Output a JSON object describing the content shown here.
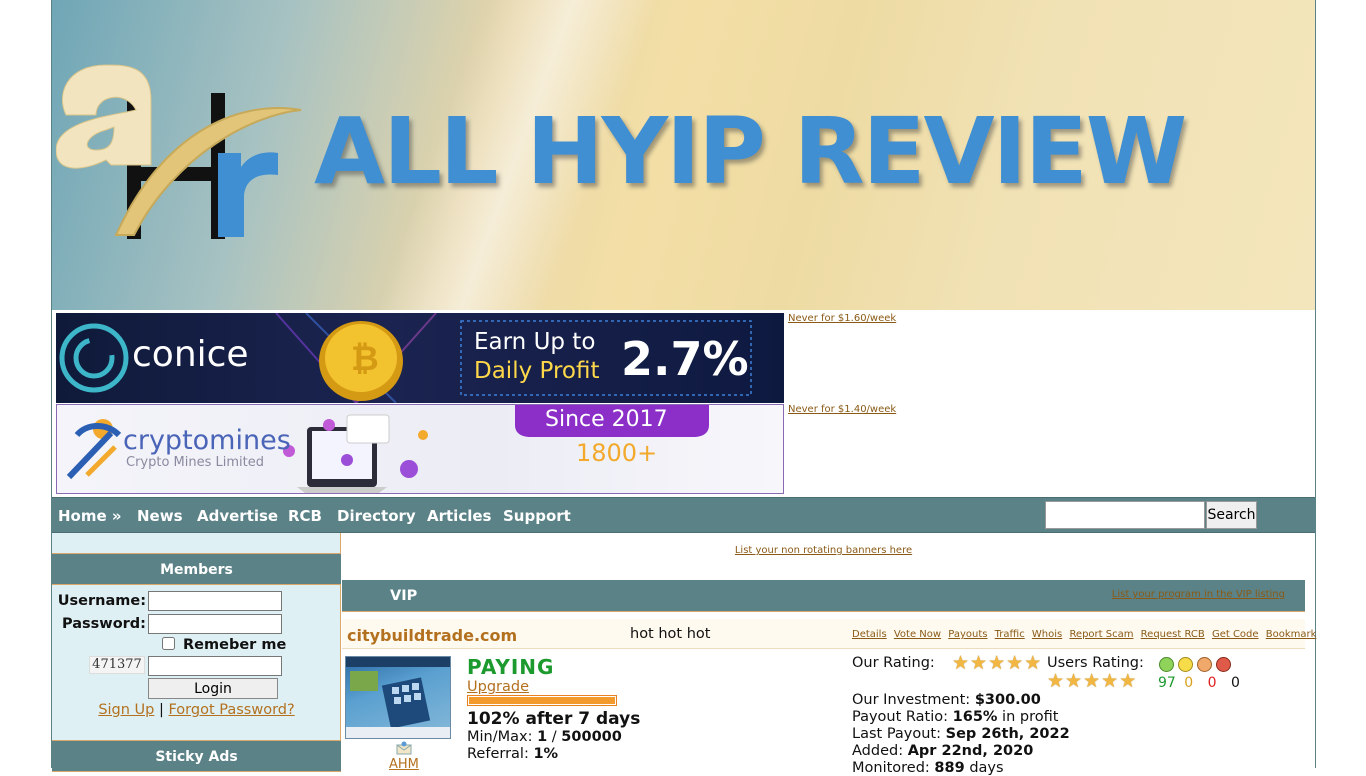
{
  "header": {
    "logo_text": "ahr",
    "title": "ALL HYIP REVIEW"
  },
  "banners": [
    {
      "brand": "conice",
      "headline_line1": "Earn Up to",
      "headline_line2": "Daily Profit",
      "figure": "2.7%",
      "side_link": "Never for $1.60/week"
    },
    {
      "brand": "cryptomines",
      "subtitle": "Crypto Mines Limited",
      "since": "Since 2017",
      "count": "1800+",
      "side_link": "Never for $1.40/week"
    }
  ],
  "nav": {
    "items": [
      "Home »",
      "News",
      "Advertise",
      "RCB",
      "Directory",
      "Articles",
      "Support"
    ],
    "search_placeholder": "",
    "search_button": "Search"
  },
  "sidebar": {
    "members_title": "Members",
    "username_label": "Username:",
    "password_label": "Password:",
    "remember_label": "Remeber me",
    "remember_checked": false,
    "captcha_text": "471377",
    "login_button": "Login",
    "signup_link": "Sign Up",
    "separator": "|",
    "forgot_link": "Forgot Password?",
    "sticky_title": "Sticky Ads"
  },
  "main": {
    "list_banners_link": "List your non rotating banners here",
    "vip_title": "VIP",
    "vip_listing_link": "List your program in the VIP listing",
    "program": {
      "name": "citybuildtrade.com",
      "tagline": "hot hot hot",
      "links": [
        "Details",
        "Vote Now",
        "Payouts",
        "Traffic",
        "Whois",
        "Report Scam",
        "Request RCB",
        "Get Code",
        "Bookmark"
      ],
      "status": "PAYING",
      "upgrade_link": "Upgrade",
      "meter_level": 1.0,
      "plan": "102% after 7 days",
      "minmax_label": "Min/Max:",
      "min": "1",
      "minmax_sep": "/",
      "max": "500000",
      "referral_label": "Referral:",
      "referral": "1%",
      "ahm_label": "AHM",
      "our_rating_label": "Our Rating:",
      "our_rating_stars": 5,
      "users_rating_label": "Users Rating:",
      "users_rating_stars": 5,
      "votes": {
        "great": "97",
        "ok": "0",
        "bad": "0",
        "scam": "0"
      },
      "investment_label": "Our Investment:",
      "investment": "$300.00",
      "payout_ratio_label": "Payout Ratio:",
      "payout_ratio": "165%",
      "payout_ratio_suffix": "in profit",
      "last_payout_label": "Last Payout:",
      "last_payout": "Sep 26th, 2022",
      "added_label": "Added:",
      "added": "Apr 22nd, 2020",
      "monitored_label": "Monitored:",
      "monitored": "889",
      "monitored_suffix": "days"
    }
  },
  "colors": {
    "nav_bg": "#5b8287",
    "title_blue": "#3f8fd2",
    "link_brown": "#b3711f",
    "paying_green": "#1c9a2e",
    "sidebar_bg": "#dff0f5"
  }
}
